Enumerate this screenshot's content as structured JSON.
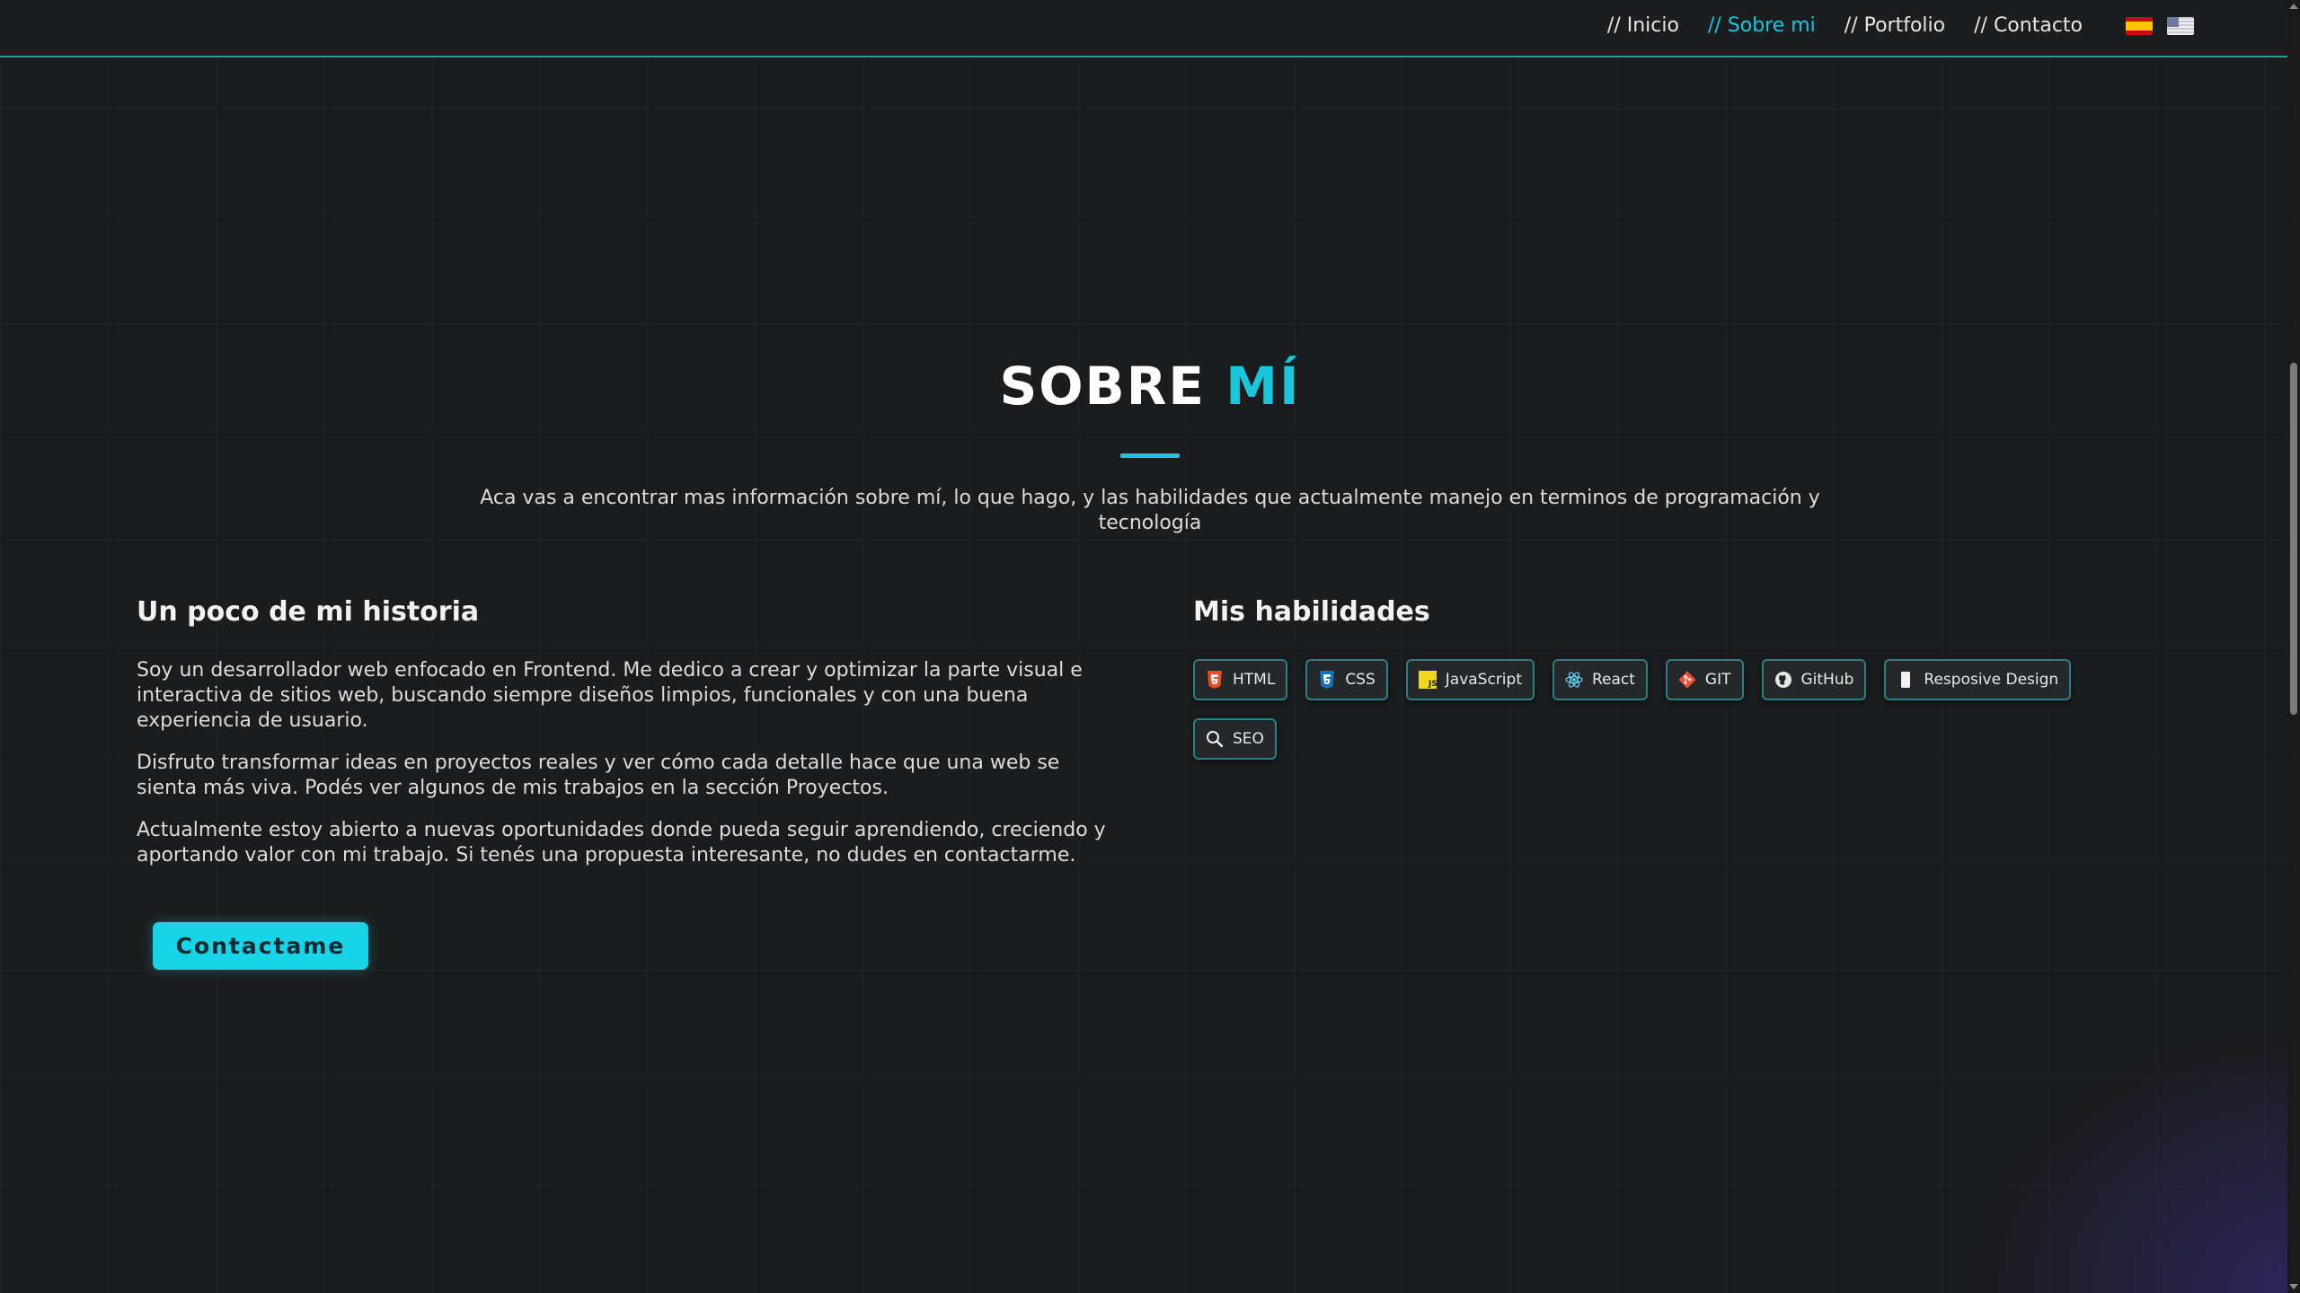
{
  "nav": {
    "links": [
      {
        "label": "// Inicio",
        "active": false
      },
      {
        "label": "// Sobre mi",
        "active": true
      },
      {
        "label": "// Portfolio",
        "active": false
      },
      {
        "label": "// Contacto",
        "active": false
      }
    ],
    "flags": [
      "spain-flag-icon",
      "usa-flag-icon"
    ]
  },
  "about": {
    "title_main": "SOBRE ",
    "title_accent": "MÍ",
    "intro": "Aca vas a encontrar mas información sobre mí, lo que hago, y las habilidades que actualmente manejo en terminos de programación y tecnología"
  },
  "story": {
    "heading": "Un poco de mi historia",
    "paragraphs": [
      "Soy un desarrollador web enfocado en Frontend. Me dedico a crear y optimizar la parte visual e interactiva de sitios web, buscando siempre diseños limpios, funcionales y con una buena experiencia de usuario.",
      "Disfruto transformar ideas en proyectos reales y ver cómo cada detalle hace que una web se sienta más viva. Podés ver algunos de mis trabajos en la sección Proyectos.",
      "Actualmente estoy abierto a nuevas oportunidades donde pueda seguir aprendiendo, creciendo y aportando valor con mi trabajo. Si tenés una propuesta interesante, no dudes en contactarme."
    ],
    "cta_label": "Contactame"
  },
  "skills": {
    "heading": "Mis habilidades",
    "items": [
      {
        "label": "HTML",
        "icon": "html5-icon"
      },
      {
        "label": "CSS",
        "icon": "css3-icon"
      },
      {
        "label": "JavaScript",
        "icon": "javascript-icon"
      },
      {
        "label": "React",
        "icon": "react-icon"
      },
      {
        "label": "GIT",
        "icon": "git-icon"
      },
      {
        "label": "GitHub",
        "icon": "github-icon"
      },
      {
        "label": "Resposive Design",
        "icon": "mobile-device-icon"
      },
      {
        "label": "SEO",
        "icon": "search-icon"
      }
    ]
  },
  "colors": {
    "accent": "#19c6db",
    "button": "#17d4e8",
    "background": "#1b1c1d"
  }
}
